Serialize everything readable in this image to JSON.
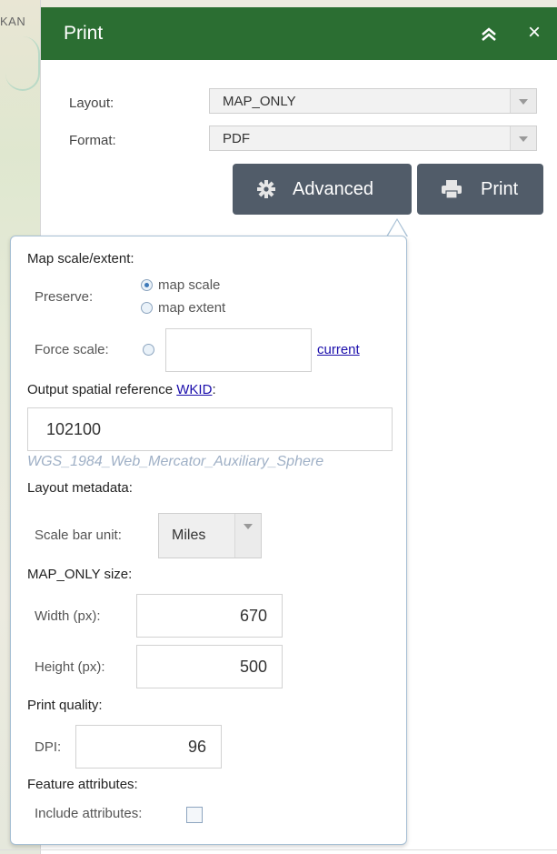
{
  "map": {
    "label": "KAN"
  },
  "header": {
    "title": "Print",
    "collapse_icon": "double-chevron-up-icon",
    "close_label": "×"
  },
  "form": {
    "layout_label": "Layout:",
    "layout_value": "MAP_ONLY",
    "format_label": "Format:",
    "format_value": "PDF",
    "advanced_button": "Advanced",
    "print_button": "Print"
  },
  "advanced": {
    "map_scale_section": "Map scale/extent:",
    "preserve_label": "Preserve:",
    "preserve_options": [
      "map scale",
      "map extent"
    ],
    "preserve_selected": "map scale",
    "force_scale_label": "Force scale:",
    "force_scale_value": "",
    "current_link": "current",
    "sr_section_prefix": "Output spatial reference",
    "sr_link": "WKID",
    "sr_suffix": ":",
    "wkid_value": "102100",
    "wkid_name": "WGS_1984_Web_Mercator_Auxiliary_Sphere",
    "layout_metadata_section": "Layout metadata:",
    "scale_bar_label": "Scale bar unit:",
    "scale_bar_value": "Miles",
    "size_section": "MAP_ONLY size:",
    "width_label": "Width (px):",
    "width_value": "670",
    "height_label": "Height (px):",
    "height_value": "500",
    "quality_section": "Print quality:",
    "dpi_label": "DPI:",
    "dpi_value": "96",
    "feature_section": "Feature attributes:",
    "include_label": "Include attributes:",
    "include_checked": false
  },
  "colors": {
    "header": "#2b6e32",
    "button": "#515c69",
    "link": "#1a0dab",
    "hint": "#9fb0c6"
  }
}
